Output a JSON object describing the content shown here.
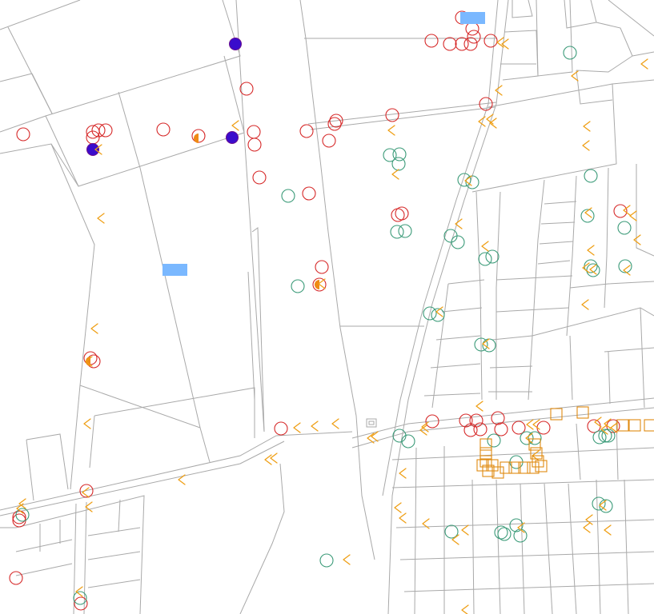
{
  "map": {
    "colors": {
      "background": "#ffffff",
      "parcel_outline": "#a9a9a9",
      "red_marker": "#d62828",
      "teal_marker": "#3a9a78",
      "blue_marker": "#3a0ccc",
      "orange_marker": "#ef9f15",
      "label_box": "#7ab8ff"
    },
    "marker_types": [
      "red-circle",
      "teal-circle",
      "blue-filled-circle",
      "orange-chevron",
      "orange-square",
      "orange-half-circle",
      "blue-label-box"
    ]
  }
}
